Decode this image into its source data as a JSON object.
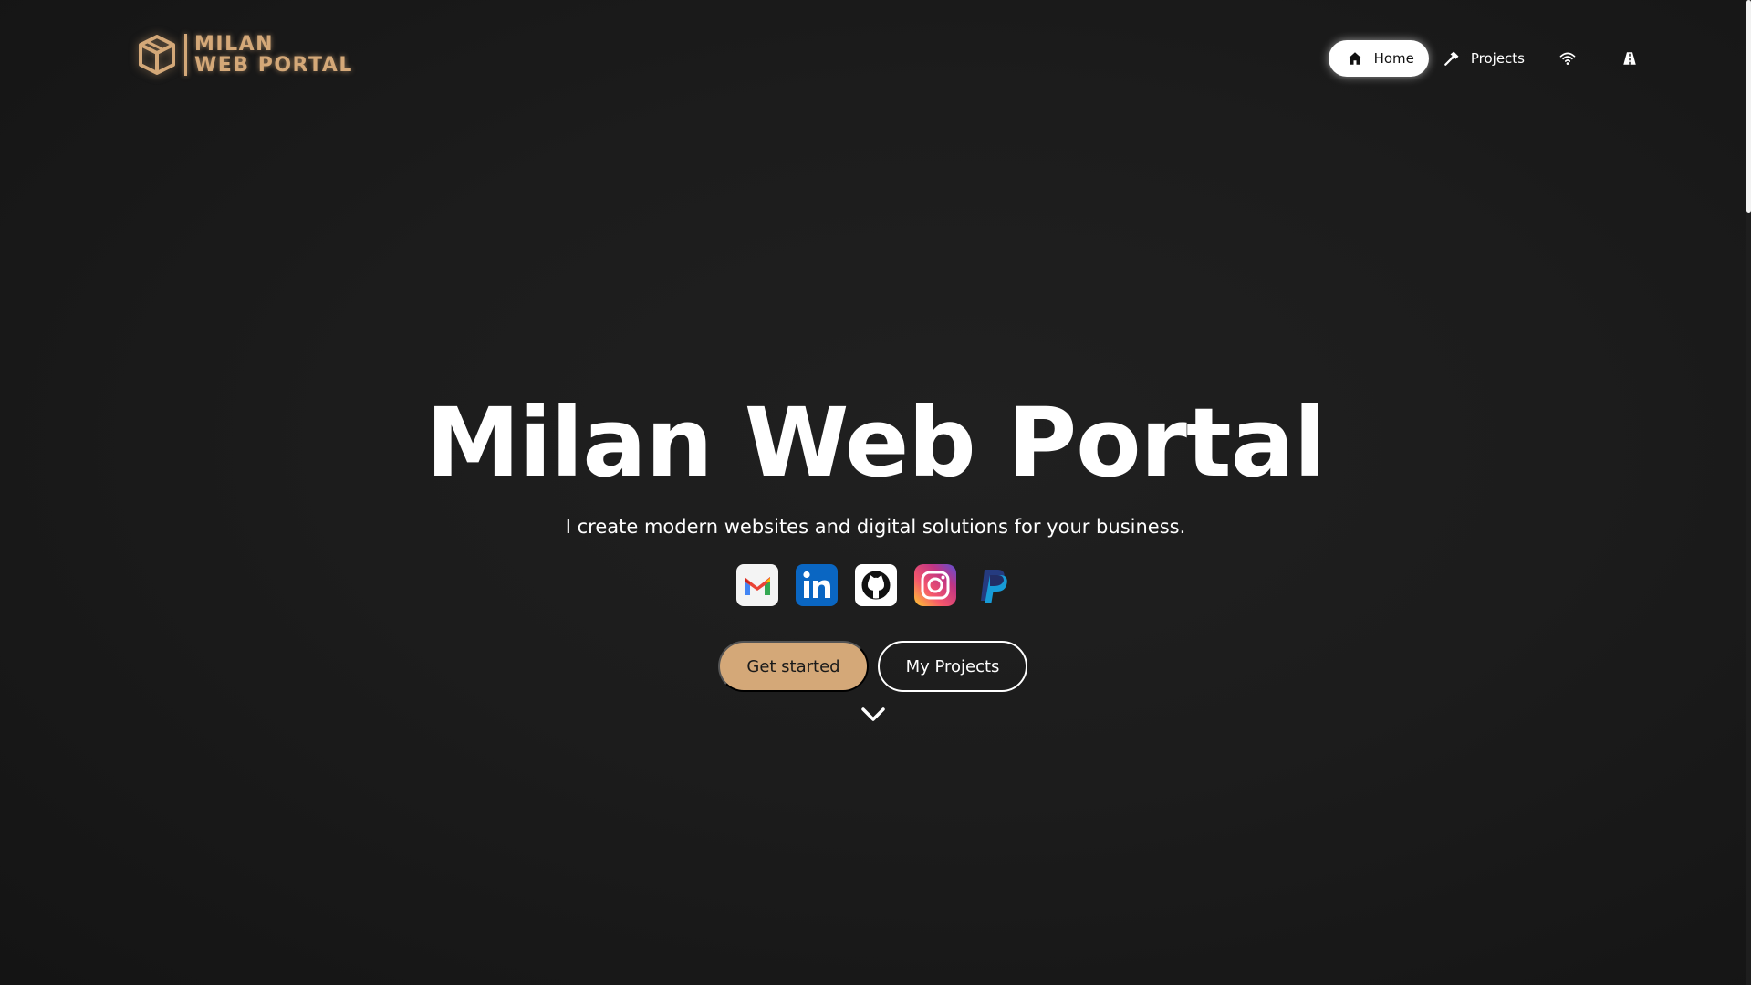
{
  "brand": {
    "line1": "MILAN",
    "line2": "WEB PORTAL",
    "accent": "#d4a878",
    "icon": "cube-icon"
  },
  "nav": {
    "items": [
      {
        "label": "Home",
        "icon": "home-icon",
        "active": true
      },
      {
        "label": "Projects",
        "icon": "hammer-icon",
        "active": false
      },
      {
        "label": "",
        "icon": "wifi-icon",
        "active": false
      },
      {
        "label": "",
        "icon": "road-icon",
        "active": false
      }
    ]
  },
  "hero": {
    "title": "Milan Web Portal",
    "subtitle": "I create modern websites and digital solutions for your business.",
    "socials": [
      "gmail-icon",
      "linkedin-icon",
      "github-icon",
      "instagram-icon",
      "paypal-icon"
    ],
    "primary_button": "Get started",
    "secondary_button": "My Projects",
    "scroll_icon": "chevron-down-icon"
  },
  "colors": {
    "background": "#1b1b1b",
    "accent": "#d4a878",
    "text": "#ffffff"
  }
}
